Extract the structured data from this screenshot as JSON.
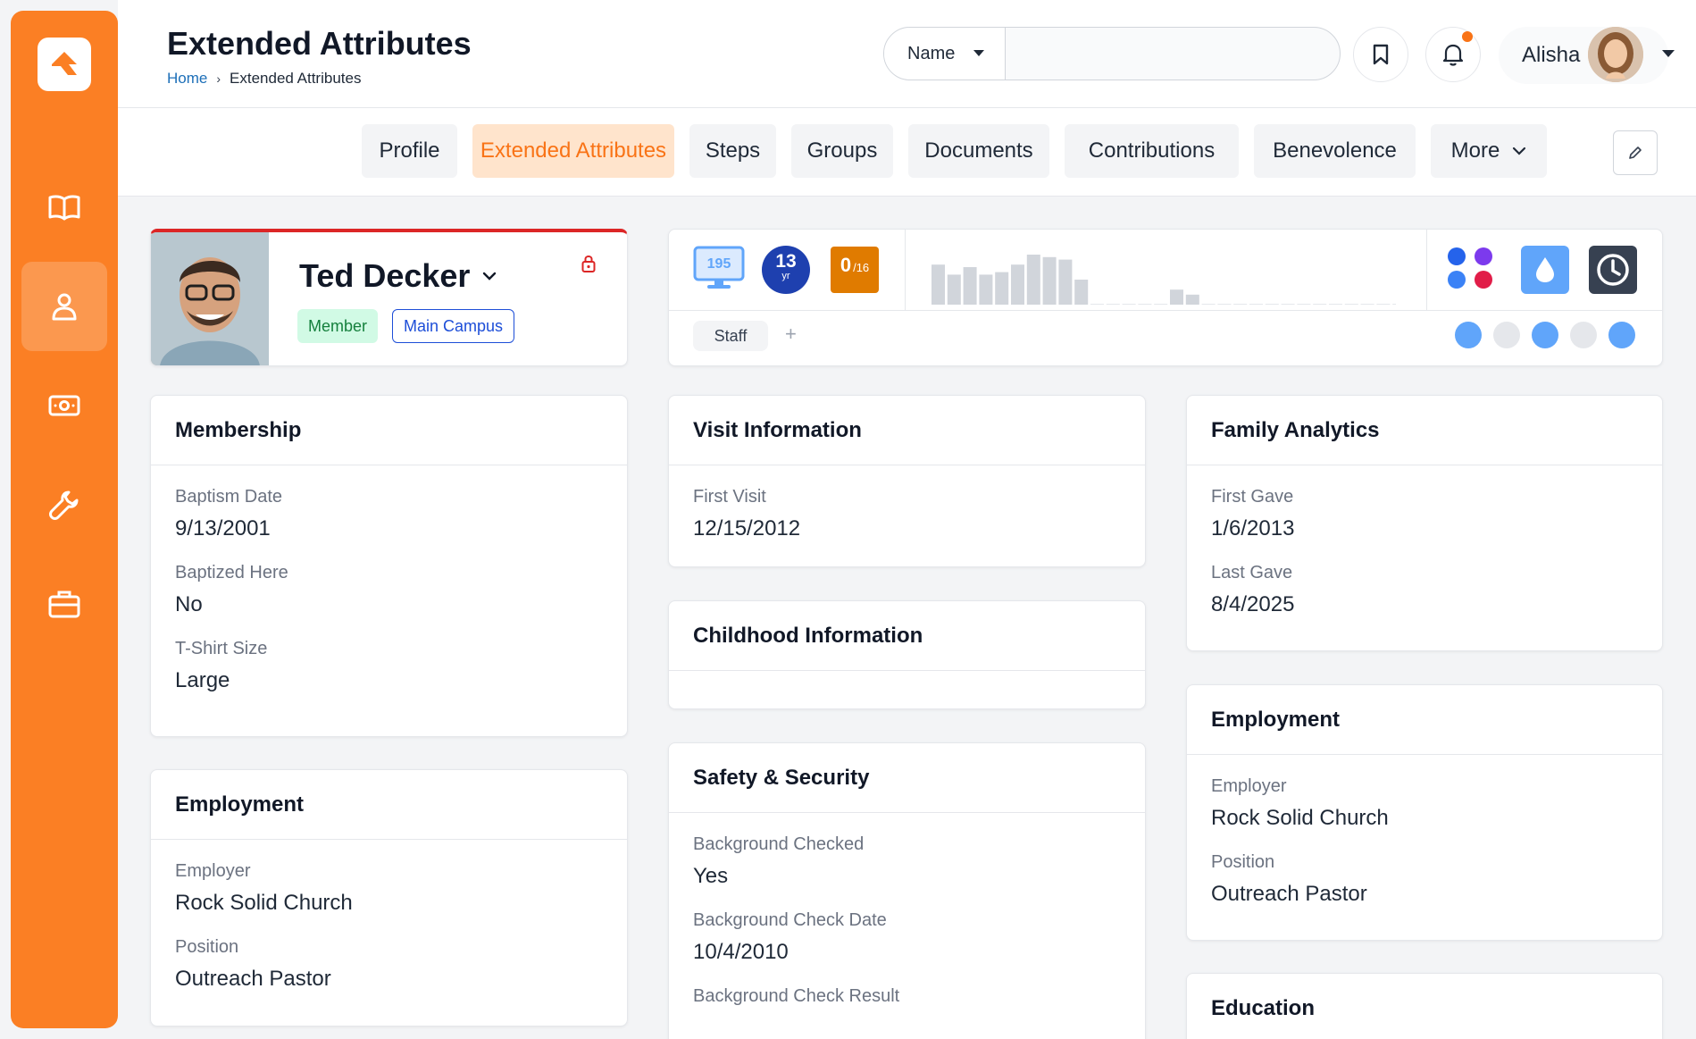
{
  "header": {
    "title": "Extended Attributes",
    "breadcrumb": [
      "Home",
      "Extended Attributes"
    ],
    "breadcrumb_separator": "›",
    "search": {
      "select_value": "Name",
      "placeholder": ""
    },
    "user_name": "Alisha"
  },
  "sidebar": {
    "items": [
      {
        "icon": "book-icon",
        "active": false
      },
      {
        "icon": "person-icon",
        "active": true
      },
      {
        "icon": "money-icon",
        "active": false
      },
      {
        "icon": "wrench-icon",
        "active": false
      },
      {
        "icon": "briefcase-icon",
        "active": false
      }
    ]
  },
  "tabs": [
    "Profile",
    "Extended Attributes",
    "Steps",
    "Groups",
    "Documents",
    "Contributions",
    "Benevolence",
    "More"
  ],
  "active_tab": "Extended Attributes",
  "person": {
    "name": "Ted Decker",
    "badges": [
      "Member",
      "Main Campus"
    ]
  },
  "stats": {
    "screen_count": "195",
    "age_value": "13",
    "age_unit": "yr",
    "score_value": "0",
    "score_total": "/16",
    "tags": [
      "Staff"
    ],
    "add_tag": "+",
    "bar_levels": [
      0.8,
      0.6,
      0.75,
      0.6,
      0.65,
      0.8,
      1.0,
      0.95,
      0.9,
      0.5,
      0,
      0,
      0,
      0,
      0,
      0.3,
      0.2,
      0,
      0,
      0,
      0,
      0,
      0,
      0,
      0,
      0,
      0,
      0,
      0,
      0,
      0,
      0
    ]
  },
  "cards": {
    "membership": {
      "title": "Membership",
      "fields": [
        {
          "label": "Baptism Date",
          "value": "9/13/2001"
        },
        {
          "label": "Baptized Here",
          "value": "No"
        },
        {
          "label": "T-Shirt Size",
          "value": "Large"
        }
      ]
    },
    "employment_left": {
      "title": "Employment",
      "fields": [
        {
          "label": "Employer",
          "value": "Rock Solid Church"
        },
        {
          "label": "Position",
          "value": "Outreach Pastor"
        }
      ]
    },
    "visit": {
      "title": "Visit Information",
      "fields": [
        {
          "label": "First Visit",
          "value": "12/15/2012"
        }
      ]
    },
    "childhood": {
      "title": "Childhood Information"
    },
    "safety": {
      "title": "Safety & Security",
      "fields": [
        {
          "label": "Background Checked",
          "value": "Yes"
        },
        {
          "label": "Background Check Date",
          "value": "10/4/2010"
        },
        {
          "label": "Background Check Result",
          "value": ""
        }
      ]
    },
    "family": {
      "title": "Family Analytics",
      "fields": [
        {
          "label": "First Gave",
          "value": "1/6/2013"
        },
        {
          "label": "Last Gave",
          "value": "8/4/2025"
        }
      ]
    },
    "employment_right": {
      "title": "Employment",
      "fields": [
        {
          "label": "Employer",
          "value": "Rock Solid Church"
        },
        {
          "label": "Position",
          "value": "Outreach Pastor"
        }
      ]
    },
    "education": {
      "title": "Education"
    }
  },
  "colors": {
    "brand_orange": "#fb7f24",
    "active_tab_bg": "#ffe4cc",
    "member_badge": "#15803d",
    "campus_badge": "#1d4ed8",
    "age_circle": "#1e40af",
    "score_box": "#e07b00"
  }
}
